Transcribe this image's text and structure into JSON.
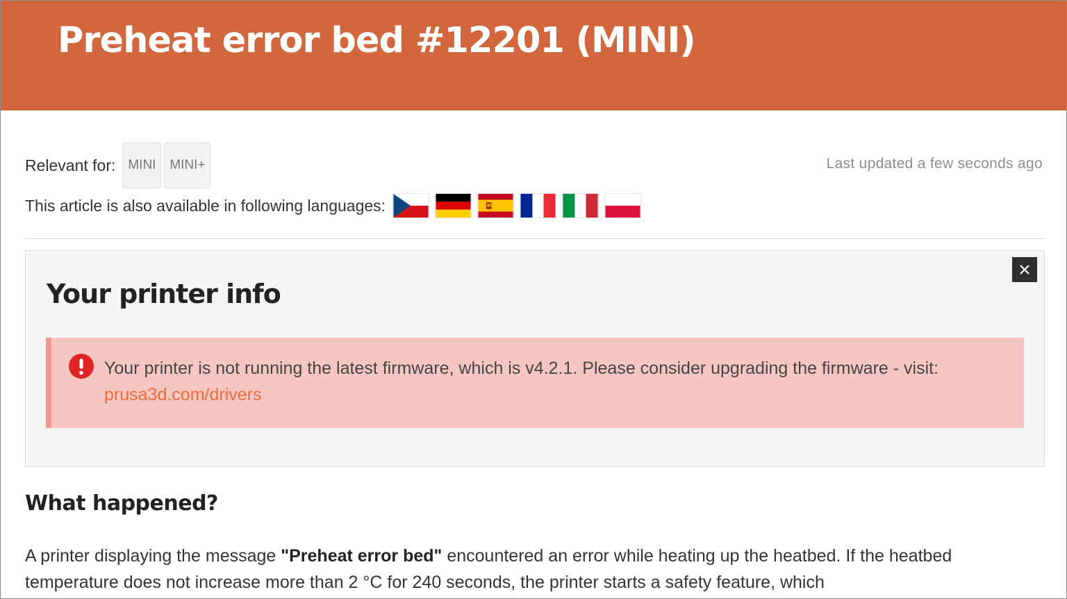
{
  "header": {
    "title": "Preheat error bed #12201 (MINI)",
    "background_color": "#d2663c"
  },
  "meta": {
    "relevant_label": "Relevant for:",
    "tags": [
      "MINI",
      "MINI+"
    ],
    "last_updated": "Last updated a few seconds ago"
  },
  "languages": {
    "label": "This article is also available in following languages:",
    "flags": [
      "cz-flag-icon",
      "de-flag-icon",
      "es-flag-icon",
      "fr-flag-icon",
      "it-flag-icon",
      "pl-flag-icon"
    ]
  },
  "printer_info": {
    "title": "Your printer info",
    "close_icon": "close-icon",
    "alert": {
      "icon": "exclamation-icon",
      "text": "Your printer is not running the latest firmware, which is v4.2.1. Please consider upgrading the firmware - visit: ",
      "link_text": "prusa3d.com/drivers",
      "background_color": "#f6c6c3",
      "link_color": "#ed6b3c"
    }
  },
  "section": {
    "title": "What happened?",
    "text_before": "A printer displaying the message ",
    "bold_text": "\"Preheat error bed\"",
    "text_after": " encountered an error while heating up the heatbed. If the heatbed temperature does not increase more than 2 °C for 240 seconds, the printer starts a safety feature, which"
  }
}
